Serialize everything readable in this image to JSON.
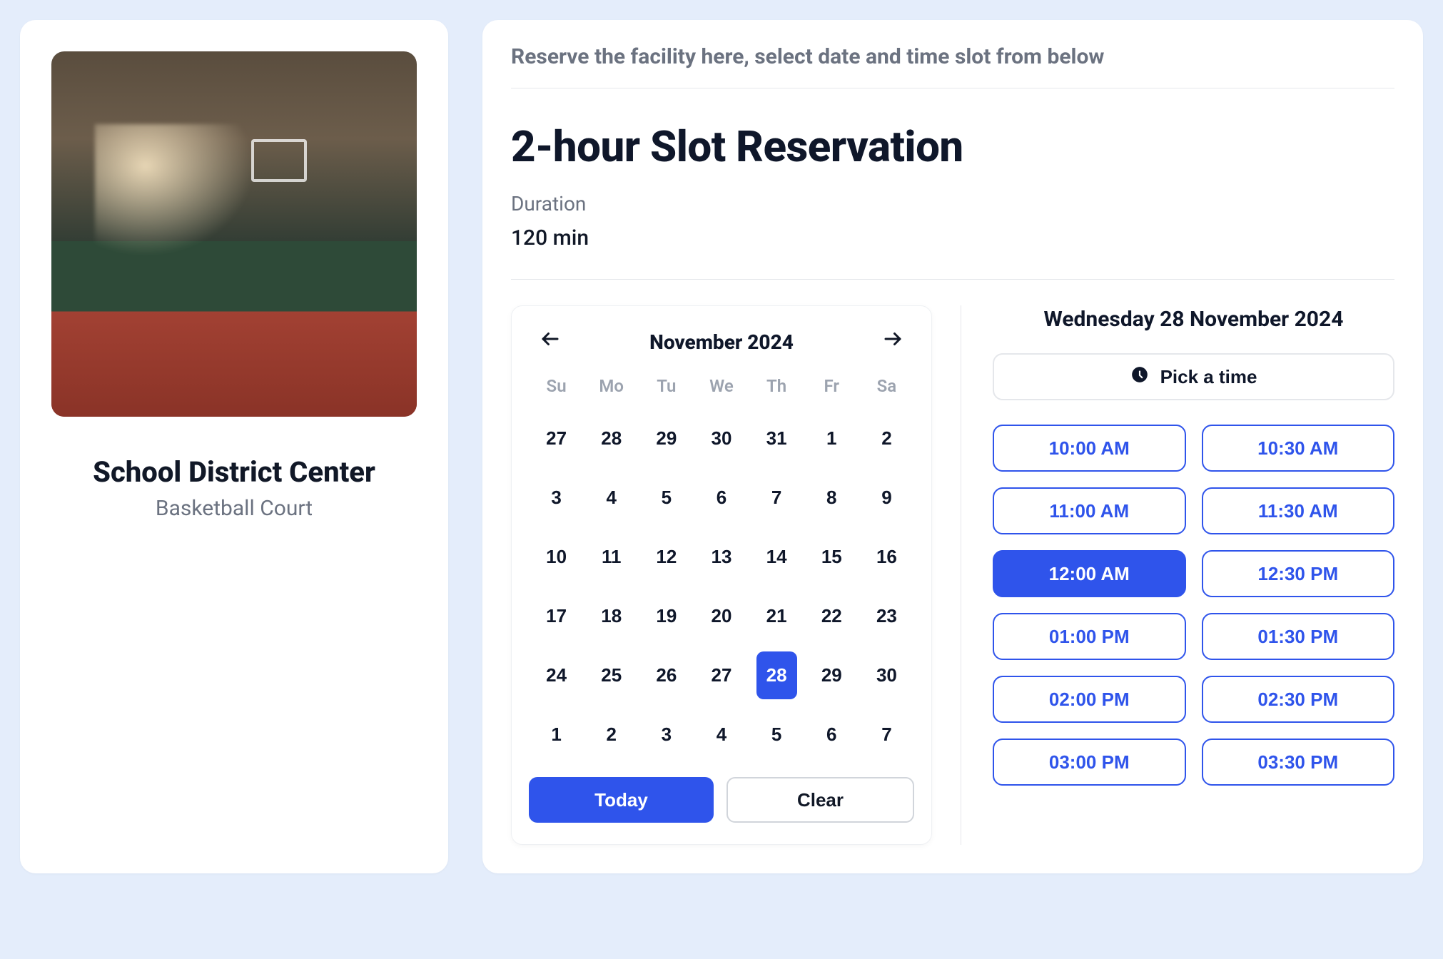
{
  "facility": {
    "name": "School District Center",
    "room": "Basketball Court"
  },
  "reservation": {
    "hint": "Reserve the facility here, select date and time slot from below",
    "heading": "2-hour Slot Reservation",
    "duration_label": "Duration",
    "duration_value": "120 min"
  },
  "calendar": {
    "month_label": "November 2024",
    "dow": [
      "Su",
      "Mo",
      "Tu",
      "We",
      "Th",
      "Fr",
      "Sa"
    ],
    "days": [
      {
        "n": "27"
      },
      {
        "n": "28"
      },
      {
        "n": "29"
      },
      {
        "n": "30"
      },
      {
        "n": "31"
      },
      {
        "n": "1"
      },
      {
        "n": "2"
      },
      {
        "n": "3"
      },
      {
        "n": "4"
      },
      {
        "n": "5"
      },
      {
        "n": "6"
      },
      {
        "n": "7"
      },
      {
        "n": "8"
      },
      {
        "n": "9"
      },
      {
        "n": "10"
      },
      {
        "n": "11"
      },
      {
        "n": "12"
      },
      {
        "n": "13"
      },
      {
        "n": "14"
      },
      {
        "n": "15"
      },
      {
        "n": "16"
      },
      {
        "n": "17"
      },
      {
        "n": "18"
      },
      {
        "n": "19"
      },
      {
        "n": "20"
      },
      {
        "n": "21"
      },
      {
        "n": "22"
      },
      {
        "n": "23"
      },
      {
        "n": "24"
      },
      {
        "n": "25"
      },
      {
        "n": "26"
      },
      {
        "n": "27"
      },
      {
        "n": "28",
        "selected": true
      },
      {
        "n": "29"
      },
      {
        "n": "30"
      },
      {
        "n": "1"
      },
      {
        "n": "2"
      },
      {
        "n": "3"
      },
      {
        "n": "4"
      },
      {
        "n": "5"
      },
      {
        "n": "6"
      },
      {
        "n": "7"
      }
    ],
    "today_label": "Today",
    "clear_label": "Clear"
  },
  "time": {
    "selected_date_label": "Wednesday 28 November 2024",
    "pick_label": "Pick a time",
    "slots": [
      {
        "t": "10:00 AM"
      },
      {
        "t": "10:30 AM"
      },
      {
        "t": "11:00 AM"
      },
      {
        "t": "11:30 AM"
      },
      {
        "t": "12:00 AM",
        "selected": true
      },
      {
        "t": "12:30 PM"
      },
      {
        "t": "01:00 PM"
      },
      {
        "t": "01:30 PM"
      },
      {
        "t": "02:00 PM"
      },
      {
        "t": "02:30 PM"
      },
      {
        "t": "03:00 PM"
      },
      {
        "t": "03:30 PM"
      }
    ]
  }
}
